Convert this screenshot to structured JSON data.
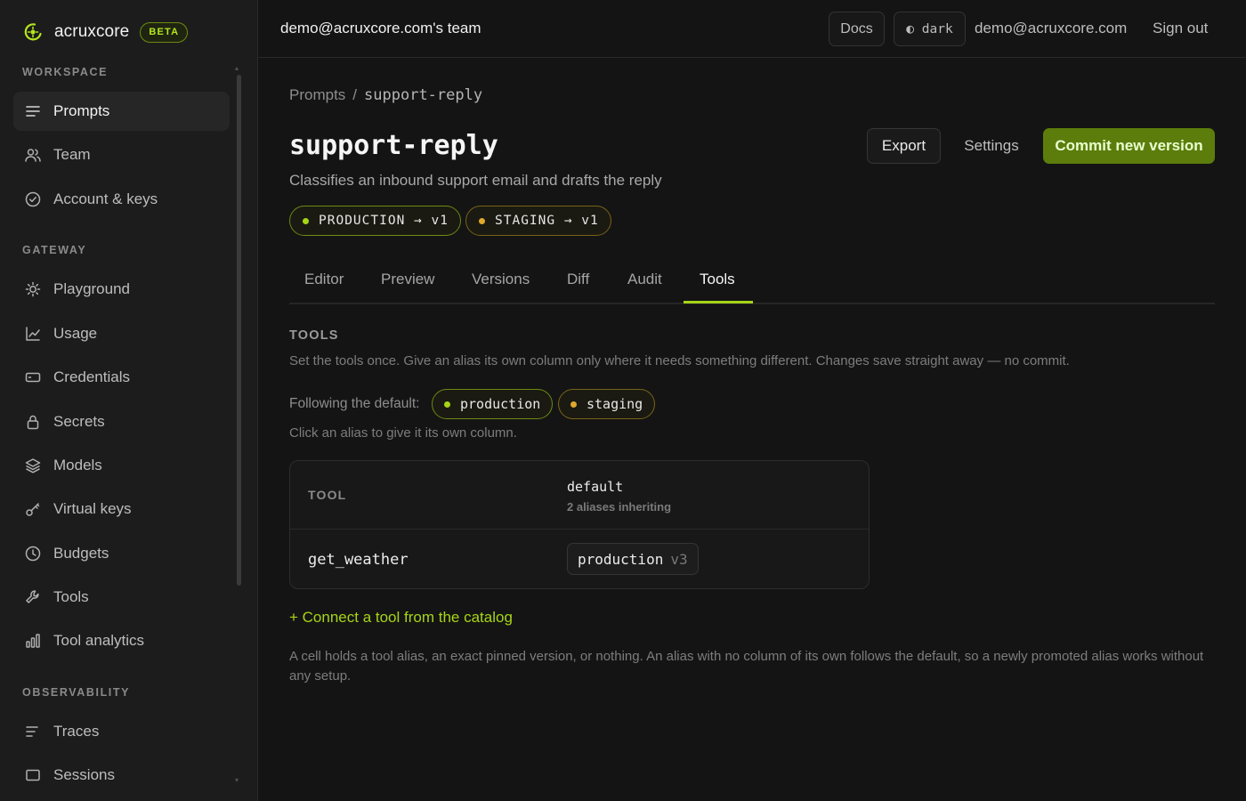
{
  "brand": {
    "name": "acruxcore",
    "badge": "BETA"
  },
  "sidebar": {
    "sections": [
      {
        "label": "WORKSPACE"
      },
      {
        "label": "GATEWAY"
      },
      {
        "label": "OBSERVABILITY"
      }
    ],
    "items": [
      {
        "label": "Prompts",
        "icon": "lines-icon",
        "active": true
      },
      {
        "label": "Team",
        "icon": "users-icon"
      },
      {
        "label": "Account & keys",
        "icon": "check-circle-icon"
      },
      {
        "label": "Playground",
        "icon": "sun-icon"
      },
      {
        "label": "Usage",
        "icon": "line-chart-icon"
      },
      {
        "label": "Credentials",
        "icon": "card-icon"
      },
      {
        "label": "Secrets",
        "icon": "lock-icon"
      },
      {
        "label": "Models",
        "icon": "layers-icon"
      },
      {
        "label": "Virtual keys",
        "icon": "key-icon"
      },
      {
        "label": "Budgets",
        "icon": "clock-icon"
      },
      {
        "label": "Tools",
        "icon": "wrench-icon"
      },
      {
        "label": "Tool analytics",
        "icon": "bar-chart-icon"
      },
      {
        "label": "Traces",
        "icon": "traces-icon"
      },
      {
        "label": "Sessions",
        "icon": "window-icon"
      }
    ]
  },
  "topbar": {
    "team": "demo@acruxcore.com's team",
    "docs": "Docs",
    "theme": "◐ dark",
    "email": "demo@acruxcore.com",
    "signout": "Sign out"
  },
  "breadcrumb": {
    "root": "Prompts",
    "sep": "/",
    "current": "support-reply"
  },
  "page": {
    "title": "support-reply",
    "subtitle": "Classifies an inbound support email and drafts the reply",
    "export": "Export",
    "settings": "Settings",
    "commit": "Commit new version"
  },
  "env_pills": [
    {
      "label": "PRODUCTION → v1",
      "color": "#a6d417"
    },
    {
      "label": "STAGING → v1",
      "color": "#e0a82e"
    }
  ],
  "tabs": [
    "Editor",
    "Preview",
    "Versions",
    "Diff",
    "Audit",
    "Tools"
  ],
  "active_tab": "Tools",
  "tools": {
    "heading": "TOOLS",
    "description": "Set the tools once. Give an alias its own column only where it needs something different. Changes save straight away — no commit.",
    "following_label": "Following the default:",
    "aliases": [
      {
        "label": "production",
        "color": "#a6d417"
      },
      {
        "label": "staging",
        "color": "#e0a82e"
      }
    ],
    "click_hint": "Click an alias to give it its own column.",
    "table": {
      "col_tool": "TOOL",
      "col_default": "default",
      "col_default_sub": "2 aliases inheriting",
      "rows": [
        {
          "name": "get_weather",
          "alias": "production",
          "version": "v3"
        }
      ]
    },
    "connect": "+ Connect a tool from the catalog",
    "footnote": "A cell holds a tool alias, an exact pinned version, or nothing. An alias with no column of its own follows the default, so a newly promoted alias works without any setup."
  }
}
